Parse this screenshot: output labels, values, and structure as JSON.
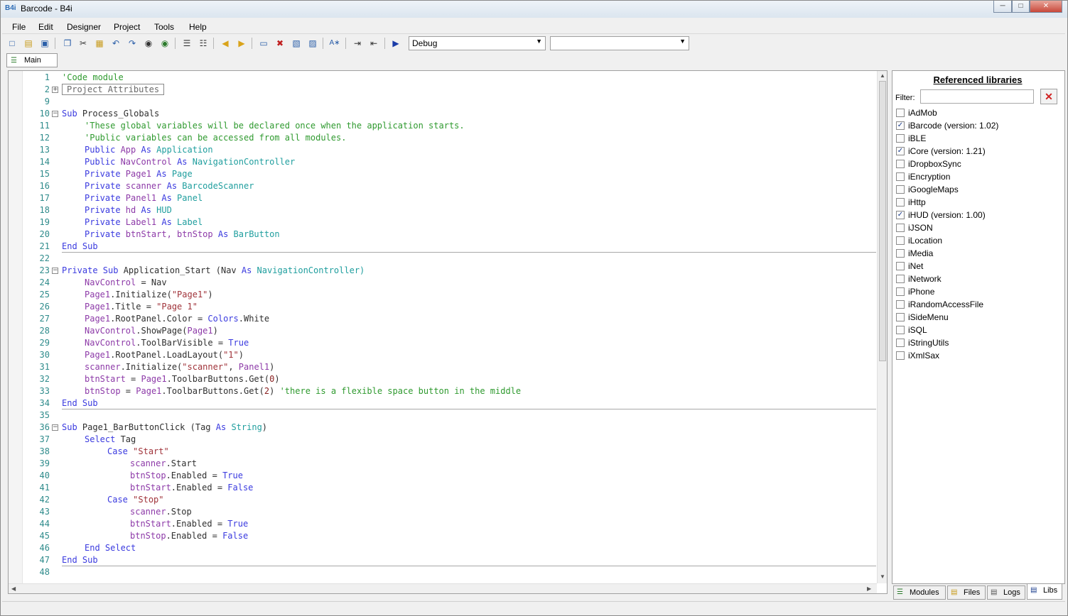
{
  "window": {
    "title": "Barcode - B4i",
    "logo": "B4i"
  },
  "window_controls": [
    {
      "name": "minimize-button",
      "symbol": "─"
    },
    {
      "name": "maximize-button",
      "symbol": "□"
    },
    {
      "name": "close-button",
      "symbol": "✕"
    }
  ],
  "menu": [
    "File",
    "Edit",
    "Designer",
    "Project",
    "Tools",
    "Help"
  ],
  "toolbar": {
    "build_config": "Debug",
    "second_combo": "",
    "icons": [
      "new-file-icon",
      "open-icon",
      "save-icon",
      "copy-icon",
      "cut-icon",
      "paste-icon",
      "undo-icon",
      "redo-icon",
      "find-icon",
      "find-all-icon",
      "outline-icon",
      "list-icon",
      "back-icon",
      "forward-icon",
      "form-icon",
      "remove-breakpoint-icon",
      "comment-icon",
      "uncomment-icon",
      "font-icon",
      "indent-icon",
      "outdent-icon",
      "run-icon"
    ]
  },
  "tabs": {
    "main": "Main"
  },
  "code_lines": [
    "1",
    "2",
    "9",
    "10",
    "11",
    "12",
    "13",
    "14",
    "15",
    "16",
    "17",
    "18",
    "19",
    "20",
    "21",
    "22",
    "23",
    "24",
    "25",
    "26",
    "27",
    "28",
    "29",
    "30",
    "31",
    "32",
    "33",
    "34",
    "35",
    "36",
    "37",
    "38",
    "39",
    "40",
    "41",
    "42",
    "43",
    "44",
    "45",
    "46",
    "47",
    "48"
  ],
  "code": {
    "l1": "'Code module",
    "l2": "Project Attributes",
    "l10a": "Sub",
    "l10b": " Process_Globals",
    "l11": "'These global variables will be declared once when the application starts.",
    "l12": "'Public variables can be accessed from all modules.",
    "l13": [
      "Public",
      " App ",
      "As",
      " Application"
    ],
    "l14": [
      "Public",
      " NavControl ",
      "As",
      " NavigationController"
    ],
    "l15": [
      "Private",
      " Page1 ",
      "As",
      " Page"
    ],
    "l16": [
      "Private",
      " scanner ",
      "As",
      " BarcodeScanner"
    ],
    "l17": [
      "Private",
      " Panel1 ",
      "As",
      " Panel"
    ],
    "l18": [
      "Private",
      " hd ",
      "As",
      " HUD"
    ],
    "l19": [
      "Private",
      " Label1 ",
      "As",
      " Label"
    ],
    "l20": [
      "Private",
      " btnStart, btnStop ",
      "As",
      " BarButton"
    ],
    "end_sub": "End Sub",
    "l23": [
      "Private Sub",
      " Application_Start (Nav ",
      "As",
      " NavigationController)"
    ],
    "l24": [
      "NavControl",
      " = Nav"
    ],
    "l25": [
      "Page1",
      ".Initialize(",
      "\"Page1\"",
      ")"
    ],
    "l26": [
      "Page1",
      ".Title = ",
      "\"Page 1\""
    ],
    "l27": [
      "Page1",
      ".RootPanel.Color = ",
      "Colors",
      ".White"
    ],
    "l28": [
      "NavControl",
      ".ShowPage(",
      "Page1",
      ")"
    ],
    "l29": [
      "NavControl",
      ".ToolBarVisible = ",
      "True"
    ],
    "l30": [
      "Page1",
      ".RootPanel.LoadLayout(",
      "\"1\"",
      ")"
    ],
    "l31": [
      "scanner",
      ".Initialize(",
      "\"scanner\"",
      ", ",
      "Panel1",
      ")"
    ],
    "l32": [
      "btnStart",
      " = ",
      "Page1",
      ".ToolbarButtons.Get(",
      "0",
      ")"
    ],
    "l33": [
      "btnStop",
      " = ",
      "Page1",
      ".ToolbarButtons.Get(",
      "2",
      ") ",
      "'there is a flexible space button in the middle"
    ],
    "l36": [
      "Sub",
      " Page1_BarButtonClick (Tag ",
      "As",
      " String",
      ")"
    ],
    "l37": [
      "Select",
      " Tag"
    ],
    "l38": [
      "Case",
      " ",
      "\"Start\""
    ],
    "l39": [
      "scanner",
      ".Start"
    ],
    "l40": [
      "btnStop",
      ".Enabled = ",
      "True"
    ],
    "l41": [
      "btnStart",
      ".Enabled = ",
      "False"
    ],
    "l42": [
      "Case",
      " ",
      "\"Stop\""
    ],
    "l43": [
      "scanner",
      ".Stop"
    ],
    "l44": [
      "btnStart",
      ".Enabled = ",
      "True"
    ],
    "l45": [
      "btnStop",
      ".Enabled = ",
      "False"
    ],
    "l46": "End Select"
  },
  "libraries": {
    "title": "Referenced libraries",
    "filter_label": "Filter:",
    "filter_value": "",
    "items": [
      {
        "name": "iAdMob",
        "checked": false
      },
      {
        "name": "iBarcode (version: 1.02)",
        "checked": true
      },
      {
        "name": "iBLE",
        "checked": false
      },
      {
        "name": "iCore (version: 1.21)",
        "checked": true
      },
      {
        "name": "iDropboxSync",
        "checked": false
      },
      {
        "name": "iEncryption",
        "checked": false
      },
      {
        "name": "iGoogleMaps",
        "checked": false
      },
      {
        "name": "iHttp",
        "checked": false
      },
      {
        "name": "iHUD (version: 1.00)",
        "checked": true
      },
      {
        "name": "iJSON",
        "checked": false
      },
      {
        "name": "iLocation",
        "checked": false
      },
      {
        "name": "iMedia",
        "checked": false
      },
      {
        "name": "iNet",
        "checked": false
      },
      {
        "name": "iNetwork",
        "checked": false
      },
      {
        "name": "iPhone",
        "checked": false
      },
      {
        "name": "iRandomAccessFile",
        "checked": false
      },
      {
        "name": "iSideMenu",
        "checked": false
      },
      {
        "name": "iSQL",
        "checked": false
      },
      {
        "name": "iStringUtils",
        "checked": false
      },
      {
        "name": "iXmlSax",
        "checked": false
      }
    ]
  },
  "bottom_tabs": [
    "Modules",
    "Files",
    "Logs",
    "Libs"
  ],
  "colors": {
    "keyword": "#3a3adf",
    "comment": "#2f9a2f",
    "type": "#1f9e9e",
    "variable": "#8d3aa8",
    "string": "#a0333a"
  }
}
